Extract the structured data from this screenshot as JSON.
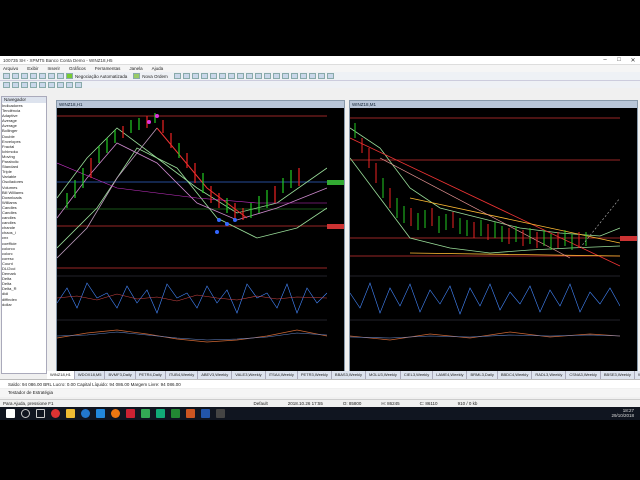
{
  "window": {
    "title": "100735 SH - XPMT5 Banco Conta Demo - WINZ18,H5",
    "minimize": "–",
    "maximize": "□",
    "close": "✕"
  },
  "menu": [
    "Arquivo",
    "Exibir",
    "Inserir",
    "Gráficos",
    "Ferramentas",
    "Janela",
    "Ajuda"
  ],
  "toolbar": {
    "auto_trading": "Negociação Automatizada",
    "new_order": "Nova Ordem"
  },
  "navigator": {
    "header": "Navegador",
    "items": [
      "Indicadores",
      "Tendência",
      "Adaptive",
      "Average",
      "Average",
      "Bollinger",
      "Double",
      "Envelopes",
      "Fractal",
      "Ichimoku",
      "Moving",
      "Parabolic",
      "Standard",
      "Triple",
      "Variable",
      "Osciladores",
      "Volumes",
      "Bill Williams",
      "Downloads",
      "Williams",
      "Candles",
      "Candles",
      "candles",
      "candles",
      "chande",
      "chaos_i",
      "cnx",
      "coefficie",
      "colorco",
      "colorc",
      "coresc",
      "Count",
      "DLI2cci",
      "Demark",
      "Delta",
      "Delta",
      "Delta_R",
      "didi",
      "diffindex",
      "dollar"
    ]
  },
  "chart_left": {
    "title": "WINZ18,H1"
  },
  "chart_right": {
    "title": "WINZ18,M1"
  },
  "tabs": [
    "WINZ18,H1",
    "WDOX18,M5",
    "BVMF3,Daily",
    "PETR4,Daily",
    "ITUB4,Weekly",
    "ABEV3,Weekly",
    "VALE3,Weekly",
    "ITSA4,Weekly",
    "PETR3,Weekly",
    "BBAS3,Weekly",
    "MGLU3,Weekly",
    "CIEL3,Weekly",
    "LAME4,Weekly",
    "BRML3,Daily",
    "BBDC4,Weekly",
    "RADL3,Weekly",
    "CSNA3,Weekly",
    "BBSE3,Weekly",
    "WEGE3,Weekly",
    "IRBR3,Weekly"
  ],
  "status": {
    "balance": "Saldo: 94 086.00 BRL  Lucro: 0.00  Capital Líquido: 94 086.00  Margem Livre: 94 086.00",
    "strategy": "Testador de Estratégia",
    "help": "Para Ajuda, pressione F1",
    "default": "Default",
    "datetime": "2018.10.26 17:55",
    "o": "O: 85800",
    "h": "H: 86245",
    "c": "C: 86110",
    "net": "910 / 0 kb"
  },
  "clock": {
    "time": "18:27",
    "date": "29/10/2018"
  }
}
